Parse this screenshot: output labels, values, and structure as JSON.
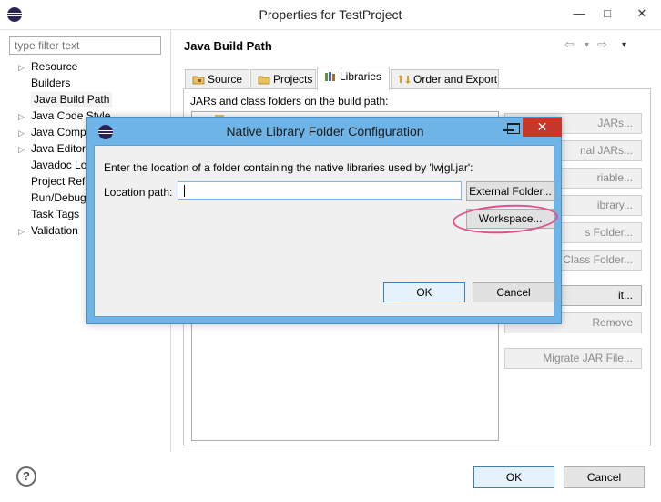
{
  "window": {
    "title": "Properties for TestProject",
    "minimize_glyph": "—",
    "maximize_glyph": "□",
    "close_glyph": "✕"
  },
  "filter": {
    "placeholder": "type filter text"
  },
  "tree": {
    "items": [
      {
        "label": "Resource",
        "expandable": true
      },
      {
        "label": "Builders",
        "expandable": false
      },
      {
        "label": "Java Build Path",
        "expandable": false,
        "selected": true
      },
      {
        "label": "Java Code Style",
        "expandable": true
      },
      {
        "label": "Java Compi",
        "expandable": true
      },
      {
        "label": "Java Editor",
        "expandable": true
      },
      {
        "label": "Javadoc Lo",
        "expandable": false
      },
      {
        "label": "Project Refe",
        "expandable": false
      },
      {
        "label": "Run/Debug",
        "expandable": false
      },
      {
        "label": "Task Tags",
        "expandable": false
      },
      {
        "label": "Validation",
        "expandable": true
      }
    ]
  },
  "page": {
    "heading": "Java Build Path",
    "nav": {
      "back": "⇦",
      "forward": "⇨",
      "dropdown": "▾",
      "menu": "▾"
    }
  },
  "tabs": [
    {
      "label": "Source",
      "active": false
    },
    {
      "label": "Projects",
      "active": false
    },
    {
      "label": "Libraries",
      "active": true
    },
    {
      "label": "Order and Export",
      "active": false
    }
  ],
  "libraries": {
    "list_label": "JARs and class folders on the build path:",
    "side_buttons": [
      {
        "label": "JARs...",
        "enabled": false
      },
      {
        "label": "nal JARs...",
        "enabled": false
      },
      {
        "label": "riable...",
        "enabled": false
      },
      {
        "label": "ibrary...",
        "enabled": false
      },
      {
        "label": "s Folder...",
        "enabled": false
      },
      {
        "label": "Class Folder...",
        "enabled": false
      },
      {
        "label": "it...",
        "enabled": true
      },
      {
        "label": "Remove",
        "enabled": false
      },
      {
        "label": "Migrate JAR File...",
        "enabled": false
      }
    ]
  },
  "footer": {
    "help": "?",
    "ok": "OK",
    "cancel": "Cancel"
  },
  "dialog": {
    "title": "Native Library Folder Configuration",
    "message": "Enter the location of a folder containing the native libraries used by 'lwjgl.jar':",
    "location_label": "Location path:",
    "location_value": "",
    "external_folder": "External Folder...",
    "workspace": "Workspace...",
    "ok": "OK",
    "cancel": "Cancel",
    "close_glyph": "✕"
  },
  "colors": {
    "dialog_frame": "#6fb4e6",
    "close_red": "#c7372c",
    "annotation_pink": "#e0508a"
  }
}
